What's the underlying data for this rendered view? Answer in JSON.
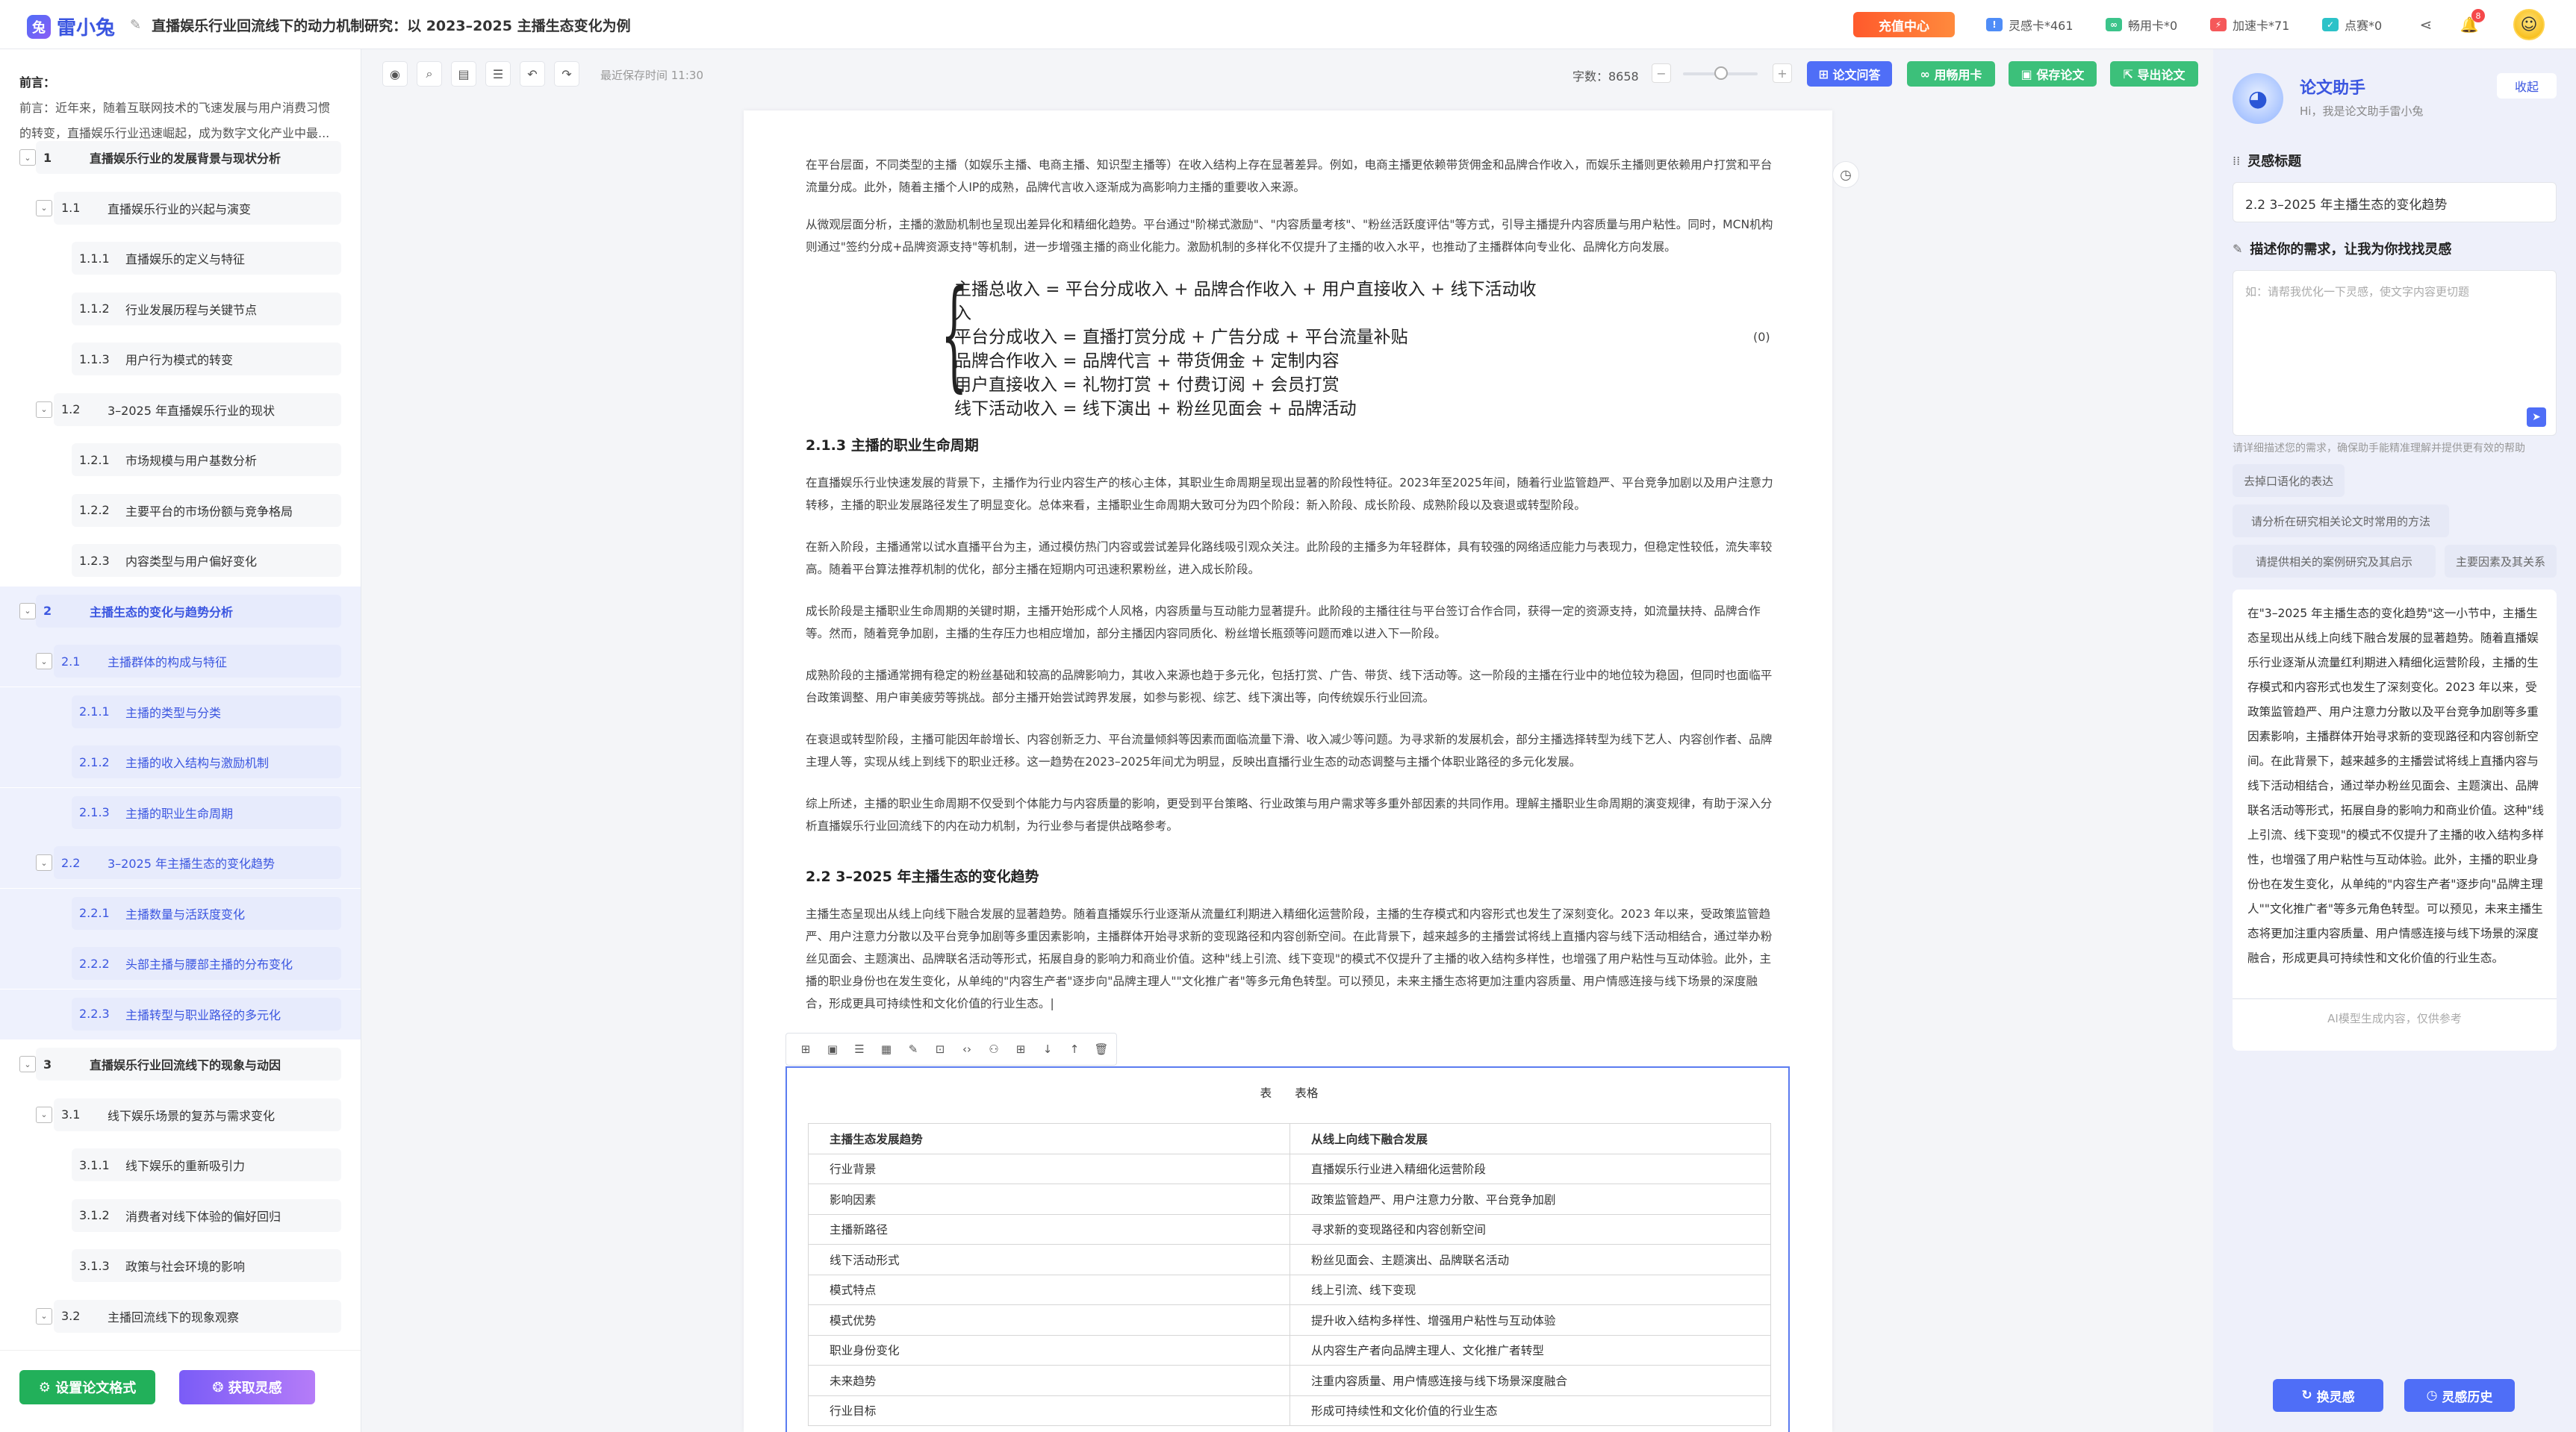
{
  "app": {
    "logo_text": "雷小兔",
    "logo_mark": "兔",
    "doc_title": "直播娱乐行业回流线下的动力机制研究：以 2023–2025 主播生态变化为例",
    "recharge": "充值中心",
    "stats": [
      {
        "icon": "!",
        "label": "灵感卡*461",
        "color": "#4f8df7"
      },
      {
        "icon": "∞",
        "label": "畅用卡*0",
        "color": "#3cc48b"
      },
      {
        "icon": "⚡",
        "label": "加速卡*71",
        "color": "#f5585a"
      },
      {
        "icon": "✓",
        "label": "点赛*0",
        "color": "#2cc2c8"
      }
    ],
    "notification_count": "8"
  },
  "sidebar": {
    "intro_title": "前言：",
    "intro_text": "前言：近年来，随着互联网技术的飞速发展与用户消费习惯的转变，直播娱乐行业迅速崛起，成为数字文化产业中最...",
    "outline": [
      {
        "num": "1",
        "title": "直播娱乐行业的发展背景与现状分析",
        "level": 1,
        "toggle": true
      },
      {
        "num": "1.1",
        "title": "直播娱乐行业的兴起与演变",
        "level": 2,
        "toggle": true
      },
      {
        "num": "1.1.1",
        "title": "直播娱乐的定义与特征",
        "level": 3
      },
      {
        "num": "1.1.2",
        "title": "行业发展历程与关键节点",
        "level": 3
      },
      {
        "num": "1.1.3",
        "title": "用户行为模式的转变",
        "level": 3
      },
      {
        "num": "1.2",
        "title": "3–2025 年直播娱乐行业的现状",
        "level": 2,
        "toggle": true
      },
      {
        "num": "1.2.1",
        "title": "市场规模与用户基数分析",
        "level": 3
      },
      {
        "num": "1.2.2",
        "title": "主要平台的市场份额与竞争格局",
        "level": 3
      },
      {
        "num": "1.2.3",
        "title": "内容类型与用户偏好变化",
        "level": 3
      },
      {
        "num": "2",
        "title": "主播生态的变化与趋势分析",
        "level": 1,
        "toggle": true,
        "active": true
      },
      {
        "num": "2.1",
        "title": "主播群体的构成与特征",
        "level": 2,
        "toggle": true,
        "active": true
      },
      {
        "num": "2.1.1",
        "title": "主播的类型与分类",
        "level": 3,
        "active": true
      },
      {
        "num": "2.1.2",
        "title": "主播的收入结构与激励机制",
        "level": 3,
        "active": true
      },
      {
        "num": "2.1.3",
        "title": "主播的职业生命周期",
        "level": 3,
        "active": true
      },
      {
        "num": "2.2",
        "title": "3–2025 年主播生态的变化趋势",
        "level": 2,
        "toggle": true,
        "active": true
      },
      {
        "num": "2.2.1",
        "title": "主播数量与活跃度变化",
        "level": 3,
        "active": true
      },
      {
        "num": "2.2.2",
        "title": "头部主播与腰部主播的分布变化",
        "level": 3,
        "active": true
      },
      {
        "num": "2.2.3",
        "title": "主播转型与职业路径的多元化",
        "level": 3,
        "active": true
      },
      {
        "num": "3",
        "title": "直播娱乐行业回流线下的现象与动因",
        "level": 1,
        "toggle": true
      },
      {
        "num": "3.1",
        "title": "线下娱乐场景的复苏与需求变化",
        "level": 2,
        "toggle": true
      },
      {
        "num": "3.1.1",
        "title": "线下娱乐的重新吸引力",
        "level": 3
      },
      {
        "num": "3.1.2",
        "title": "消费者对线下体验的偏好回归",
        "level": 3
      },
      {
        "num": "3.1.3",
        "title": "政策与社会环境的影响",
        "level": 3
      },
      {
        "num": "3.2",
        "title": "主播回流线下的现象观察",
        "level": 2,
        "toggle": true
      }
    ],
    "btn_format": "设置论文格式",
    "btn_inspire": "获取灵感"
  },
  "toolbar": {
    "saved": "最近保存时间 11:30",
    "wordcount": "字数：8658",
    "btn_qa": "论文问答",
    "btn_card": "用畅用卡",
    "btn_save": "保存论文",
    "btn_export": "导出论文"
  },
  "doc": {
    "p0": "在平台层面，不同类型的主播（如娱乐主播、电商主播、知识型主播等）在收入结构上存在显著差异。例如，电商主播更依赖带货佣金和品牌合作收入，而娱乐主播则更依赖用户打赏和平台流量分成。此外，随着主播个人IP的成熟，品牌代言收入逐渐成为高影响力主播的重要收入来源。",
    "p1": "从微观层面分析，主播的激励机制也呈现出差异化和精细化趋势。平台通过\"阶梯式激励\"、\"内容质量考核\"、\"粉丝活跃度评估\"等方式，引导主播提升内容质量与用户粘性。同时，MCN机构则通过\"签约分成+品牌资源支持\"等机制，进一步增强主播的商业化能力。激励机制的多样化不仅提升了主播的收入水平，也推动了主播群体向专业化、品牌化方向发展。",
    "formula": [
      "主播总收入 = 平台分成收入 + 品牌合作收入 + 用户直接收入 + 线下活动收入",
      "平台分成收入 = 直播打赏分成 + 广告分成 + 平台流量补贴",
      "品牌合作收入 = 品牌代言 + 带货佣金 + 定制内容",
      "用户直接收入 = 礼物打赏 + 付费订阅 + 会员打赏",
      "线下活动收入 = 线下演出 + 粉丝见面会 + 品牌活动"
    ],
    "eqno": "(0)",
    "h_213": "2.1.3 主播的职业生命周期",
    "p2": "在直播娱乐行业快速发展的背景下，主播作为行业内容生产的核心主体，其职业生命周期呈现出显著的阶段性特征。2023年至2025年间，随着行业监管趋严、平台竞争加剧以及用户注意力转移，主播的职业发展路径发生了明显变化。总体来看，主播职业生命周期大致可分为四个阶段：新入阶段、成长阶段、成熟阶段以及衰退或转型阶段。",
    "p3": "在新入阶段，主播通常以试水直播平台为主，通过模仿热门内容或尝试差异化路线吸引观众关注。此阶段的主播多为年轻群体，具有较强的网络适应能力与表现力，但稳定性较低，流失率较高。随着平台算法推荐机制的优化，部分主播在短期内可迅速积累粉丝，进入成长阶段。",
    "p4": "成长阶段是主播职业生命周期的关键时期，主播开始形成个人风格，内容质量与互动能力显著提升。此阶段的主播往往与平台签订合作合同，获得一定的资源支持，如流量扶持、品牌合作等。然而，随着竞争加剧，主播的生存压力也相应增加，部分主播因内容同质化、粉丝增长瓶颈等问题而难以进入下一阶段。",
    "p5": "成熟阶段的主播通常拥有稳定的粉丝基础和较高的品牌影响力，其收入来源也趋于多元化，包括打赏、广告、带货、线下活动等。这一阶段的主播在行业中的地位较为稳固，但同时也面临平台政策调整、用户审美疲劳等挑战。部分主播开始尝试跨界发展，如参与影视、综艺、线下演出等，向传统娱乐行业回流。",
    "p6": "在衰退或转型阶段，主播可能因年龄增长、内容创新乏力、平台流量倾斜等因素而面临流量下滑、收入减少等问题。为寻求新的发展机会，部分主播选择转型为线下艺人、内容创作者、品牌主理人等，实现从线上到线下的职业迁移。这一趋势在2023–2025年间尤为明显，反映出直播行业生态的动态调整与主播个体职业路径的多元化发展。",
    "p7": "综上所述，主播的职业生命周期不仅受到个体能力与内容质量的影响，更受到平台策略、行业政策与用户需求等多重外部因素的共同作用。理解主播职业生命周期的演变规律，有助于深入分析直播娱乐行业回流线下的内在动力机制，为行业参与者提供战略参考。",
    "h_22": "2.2 3–2025 年主播生态的变化趋势",
    "p8": "主播生态呈现出从线上向线下融合发展的显著趋势。随着直播娱乐行业逐渐从流量红利期进入精细化运营阶段，主播的生存模式和内容形式也发生了深刻变化。2023 年以来，受政策监管趋严、用户注意力分散以及平台竞争加剧等多重因素影响，主播群体开始寻求新的变现路径和内容创新空间。在此背景下，越来越多的主播尝试将线上直播内容与线下活动相结合，通过举办粉丝见面会、主题演出、品牌联名活动等形式，拓展自身的影响力和商业价值。这种\"线上引流、线下变现\"的模式不仅提升了主播的收入结构多样性，也增强了用户粘性与互动体验。此外，主播的职业身份也在发生变化，从单纯的\"内容生产者\"逐步向\"品牌主理人\"\"文化推广者\"等多元角色转型。可以预见，未来主播生态将更加注重内容质量、用户情感连接与线下场景的深度融合，形成更具可持续性和文化价值的行业生态。|",
    "table_toolbar": [
      "⊞",
      "▣",
      "☰",
      "▦",
      "✎",
      "⊡",
      "‹›",
      "⚇",
      "⊞",
      "↓",
      "↑",
      "🗑"
    ],
    "table_caption": "表　　表格",
    "table_header": [
      "主播生态发展趋势",
      "从线上向线下融合发展"
    ],
    "table_rows": [
      [
        "行业背景",
        "直播娱乐行业进入精细化运营阶段"
      ],
      [
        "影响因素",
        "政策监管趋严、用户注意力分散、平台竞争加剧"
      ],
      [
        "主播新路径",
        "寻求新的变现路径和内容创新空间"
      ],
      [
        "线下活动形式",
        "粉丝见面会、主题演出、品牌联名活动"
      ],
      [
        "模式特点",
        "线上引流、线下变现"
      ],
      [
        "模式优势",
        "提升收入结构多样性、增强用户粘性与互动体验"
      ],
      [
        "职业身份变化",
        "从内容生产者向品牌主理人、文化推广者转型"
      ],
      [
        "未来趋势",
        "注重内容质量、用户情感连接与线下场景深度融合"
      ],
      [
        "行业目标",
        "形成可持续性和文化价值的行业生态"
      ]
    ]
  },
  "assistant": {
    "name": "论文助手",
    "sub": "Hi，我是论文助手雷小兔",
    "collapse": "收起",
    "title_label": "灵感标题",
    "title_value": "2.2 3–2025 年主播生态的变化趋势",
    "need_label": "描述你的需求，让我为你找找灵感",
    "need_placeholder": "如：请帮我优化一下灵感，使文字内容更切题",
    "hint": "请详细描述您的需求，确保助手能精准理解并提供更有效的帮助",
    "chips": [
      "去掉口语化的表达",
      "请分析在研究相关论文时常用的方法",
      "请提供相关的案例研究及其启示",
      "主要因素及其关系"
    ],
    "answer": "在\"3–2025 年主播生态的变化趋势\"这一小节中，主播生态呈现出从线上向线下融合发展的显著趋势。随着直播娱乐行业逐渐从流量红利期进入精细化运营阶段，主播的生存模式和内容形式也发生了深刻变化。2023 年以来，受政策监管趋严、用户注意力分散以及平台竞争加剧等多重因素影响，主播群体开始寻求新的变现路径和内容创新空间。在此背景下，越来越多的主播尝试将线上直播内容与线下活动相结合，通过举办粉丝见面会、主题演出、品牌联名活动等形式，拓展自身的影响力和商业价值。这种\"线上引流、线下变现\"的模式不仅提升了主播的收入结构多样性，也增强了用户粘性与互动体验。此外，主播的职业身份也在发生变化，从单纯的\"内容生产者\"逐步向\"品牌主理人\"\"文化推广者\"等多元角色转型。可以预见，未来主播生态将更加注重内容质量、用户情感连接与线下场景的深度融合，形成更具可持续性和文化价值的行业生态。",
    "note": "AI模型生成内容，仅供参考",
    "btn_change": "换灵感",
    "btn_history": "灵感历史"
  }
}
